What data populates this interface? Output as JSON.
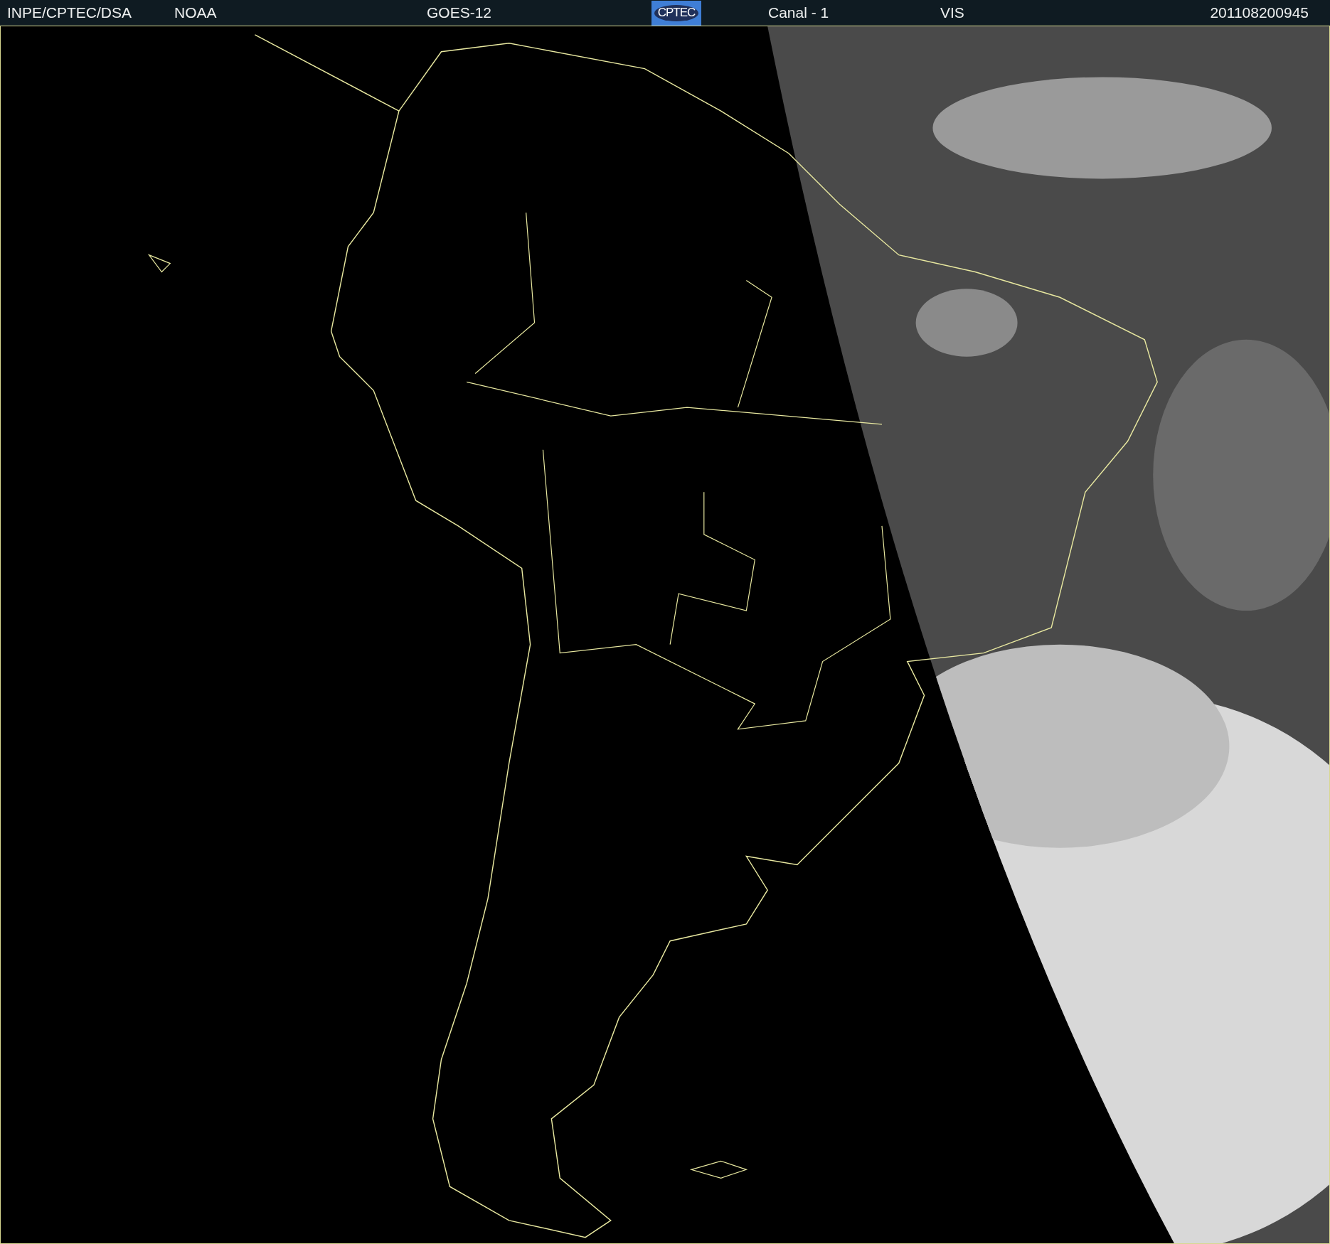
{
  "header": {
    "items": [
      {
        "kind": "text",
        "text": "INPE/CPTEC/DSA"
      },
      {
        "kind": "text",
        "text": "NOAA"
      },
      {
        "kind": "text",
        "text": "GOES-12"
      },
      {
        "kind": "logo",
        "text": "CPTEC"
      },
      {
        "kind": "text",
        "text": "Canal - 1"
      },
      {
        "kind": "text",
        "text": "VIS"
      },
      {
        "kind": "text",
        "text": "201108200945"
      }
    ]
  }
}
